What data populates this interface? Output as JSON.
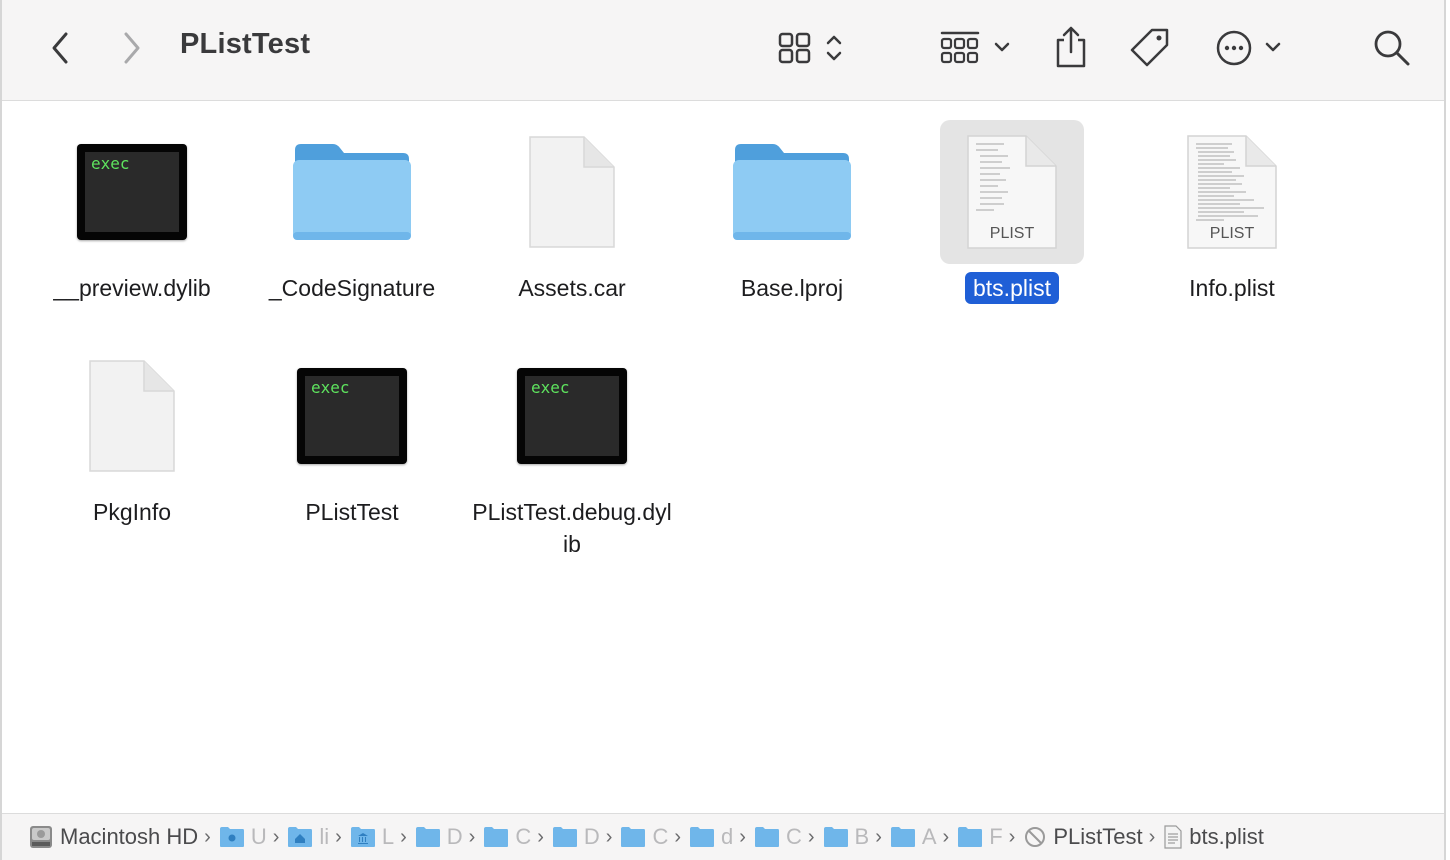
{
  "window": {
    "title": "PListTest"
  },
  "toolbar": {
    "back": "back-icon",
    "forward": "forward-icon",
    "view": "grid-view-icon",
    "group": "group-icon",
    "share": "share-icon",
    "tag": "tag-icon",
    "more": "more-icon",
    "search": "search-icon"
  },
  "files": [
    {
      "name": "__preview.dylib",
      "kind": "exec",
      "exec_text": "exec"
    },
    {
      "name": "_CodeSignature",
      "kind": "folder"
    },
    {
      "name": "Assets.car",
      "kind": "document"
    },
    {
      "name": "Base.lproj",
      "kind": "folder"
    },
    {
      "name": "bts.plist",
      "kind": "plist",
      "plist_text": "PLIST",
      "selected": true
    },
    {
      "name": "Info.plist",
      "kind": "plist",
      "plist_text": "PLIST"
    },
    {
      "name": "PkgInfo",
      "kind": "document"
    },
    {
      "name": "PListTest",
      "kind": "exec",
      "exec_text": "exec"
    },
    {
      "name": "PListTest.debug.dylib",
      "kind": "exec",
      "exec_text": "exec"
    }
  ],
  "pathbar": [
    {
      "label": "Macintosh HD",
      "icon": "hard-drive-icon"
    },
    {
      "label": "U",
      "icon": "users-folder-icon",
      "faded": true
    },
    {
      "label": "li",
      "icon": "home-folder-icon",
      "faded": true
    },
    {
      "label": "L",
      "icon": "library-folder-icon",
      "faded": true
    },
    {
      "label": "D",
      "icon": "folder-icon",
      "faded": true
    },
    {
      "label": "C",
      "icon": "folder-icon",
      "faded": true
    },
    {
      "label": "D",
      "icon": "folder-icon",
      "faded": true
    },
    {
      "label": "C",
      "icon": "folder-icon",
      "faded": true
    },
    {
      "label": "d",
      "icon": "folder-icon",
      "faded": true
    },
    {
      "label": "C",
      "icon": "folder-icon",
      "faded": true
    },
    {
      "label": "B",
      "icon": "folder-icon",
      "faded": true
    },
    {
      "label": "A",
      "icon": "folder-icon",
      "faded": true
    },
    {
      "label": "F",
      "icon": "folder-icon",
      "faded": true
    },
    {
      "label": "PListTest",
      "icon": "app-disabled-icon"
    },
    {
      "label": "bts.plist",
      "icon": "plist-file-icon"
    }
  ],
  "colors": {
    "selection": "#1f5fd6",
    "folder": "#8ecbf3",
    "exec_text": "#5ee35e"
  }
}
